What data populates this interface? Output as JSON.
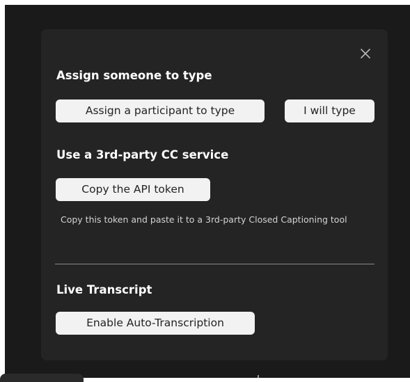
{
  "panel": {
    "close_icon": "close-icon",
    "assign_section": {
      "title": "Assign someone to type",
      "assign_participant_label": "Assign a participant to type",
      "i_will_type_label": "I will type"
    },
    "third_party_section": {
      "title": "Use a 3rd-party CC service",
      "copy_token_label": "Copy the API token",
      "hint": "Copy this token and paste it to a 3rd-party Closed Captioning tool"
    },
    "live_transcript_section": {
      "title": "Live Transcript",
      "enable_label": "Enable Auto-Transcription"
    }
  },
  "colors": {
    "background": "#1a1a1a",
    "panel": "#242424",
    "button": "#f2f2f2",
    "button_text": "#232323",
    "text": "#ffffff",
    "divider": "#8a8a8a"
  }
}
